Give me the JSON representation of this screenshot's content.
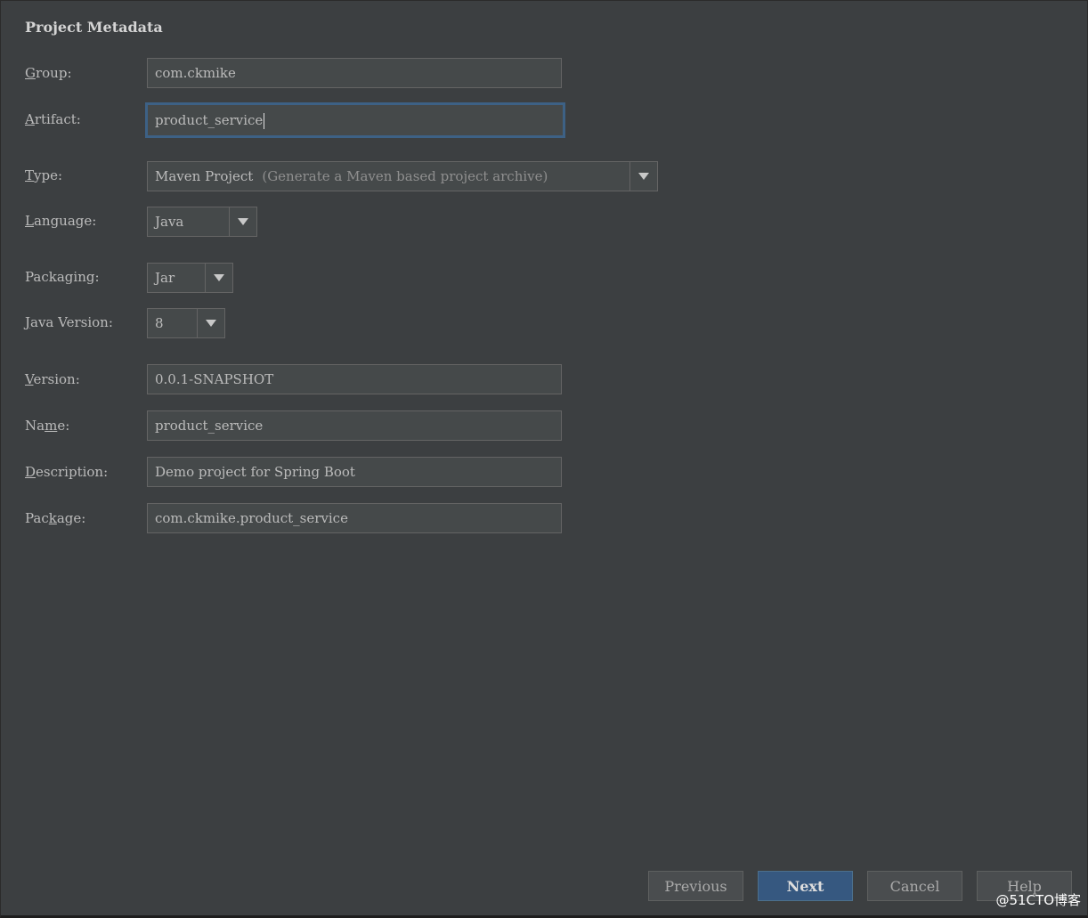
{
  "section": {
    "title": "Project Metadata"
  },
  "form": {
    "group": {
      "label_first": "G",
      "label_rest": "roup:",
      "value": "com.ckmike"
    },
    "artifact": {
      "label_pre": "",
      "label_u": "A",
      "label_rest": "rtifact:",
      "value": "product_service"
    },
    "type": {
      "label_u": "T",
      "label_rest": "ype:",
      "value": "Maven Project",
      "hint": "(Generate a Maven based project archive)"
    },
    "language": {
      "label_u": "L",
      "label_rest": "anguage:",
      "value": "Java"
    },
    "packaging": {
      "label": "Packaging:",
      "value": "Jar"
    },
    "java_version": {
      "label_u": "J",
      "label_rest": "ava Version:",
      "value": "8"
    },
    "version": {
      "label_u": "V",
      "label_rest": "ersion:",
      "value": "0.0.1-SNAPSHOT"
    },
    "name": {
      "label_pre": "Na",
      "label_u": "m",
      "label_rest": "e:",
      "value": "product_service"
    },
    "description": {
      "label_u": "D",
      "label_rest": "escription:",
      "value": "Demo project for Spring Boot"
    },
    "package": {
      "label_pre": "Pac",
      "label_u": "k",
      "label_rest": "age:",
      "value": "com.ckmike.product_service"
    }
  },
  "buttons": {
    "previous": "Previous",
    "next": "Next",
    "cancel": "Cancel",
    "help": "Help"
  },
  "watermark": "@51CTO博客",
  "icons": {
    "dropdown": "chevron-down-icon"
  },
  "colors": {
    "background": "#3c3f41",
    "field": "#45494a",
    "focus_border": "#3d6185",
    "primary_button": "#365880"
  }
}
